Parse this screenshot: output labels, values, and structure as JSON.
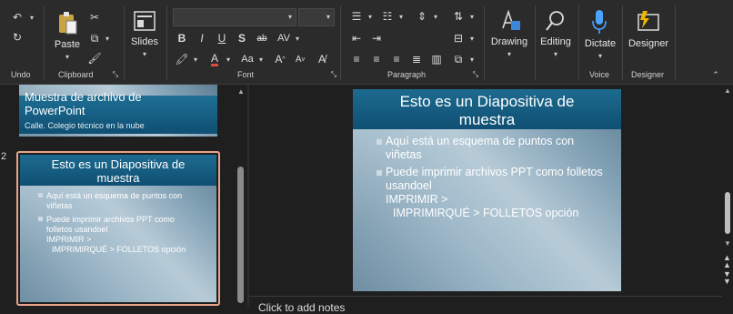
{
  "ribbon": {
    "groups": {
      "undo": "Undo",
      "clipboard": "Clipboard",
      "font": "Font",
      "paragraph": "Paragraph",
      "voice": "Voice",
      "designer": "Designer"
    },
    "paste_label": "Paste",
    "slides_label": "Slides",
    "drawing_label": "Drawing",
    "editing_label": "Editing",
    "dictate_label": "Dictate",
    "designer_label": "Designer",
    "font_buttons": [
      "B",
      "I",
      "U",
      "S",
      "ab",
      "AV"
    ],
    "font_size_buttons": [
      "A",
      "A"
    ]
  },
  "thumbnails": {
    "slide1": {
      "title": "Muestra de archivo de PowerPoint",
      "subtitle": "Calle. Colegio técnico en la nube"
    },
    "slide2": {
      "number": "2",
      "title": "Esto es un Diapositiva de muestra",
      "bullets": [
        "Aquí está un esquema de puntos con viñetas",
        "Puede imprimir archivos PPT como folletos usandoel"
      ],
      "line3": "IMPRIMIR >",
      "line4": "IMPRIMIRQUÉ > FOLLETOS opción"
    }
  },
  "main_slide": {
    "title": "Esto es un Diapositiva de muestra",
    "bullets": [
      "Aquí está un esquema de puntos con viñetas",
      "Puede imprimir archivos PPT como folletos usandoel"
    ],
    "line3": "IMPRIMIR >",
    "line4": "IMPRIMIRQUÉ > FOLLETOS opción"
  },
  "notes": {
    "placeholder": "Click to add notes"
  },
  "colors": {
    "accent_selection": "#e7a48a",
    "dictate_mic": "#4aa3ff",
    "designer_icon": "#f0b400"
  }
}
